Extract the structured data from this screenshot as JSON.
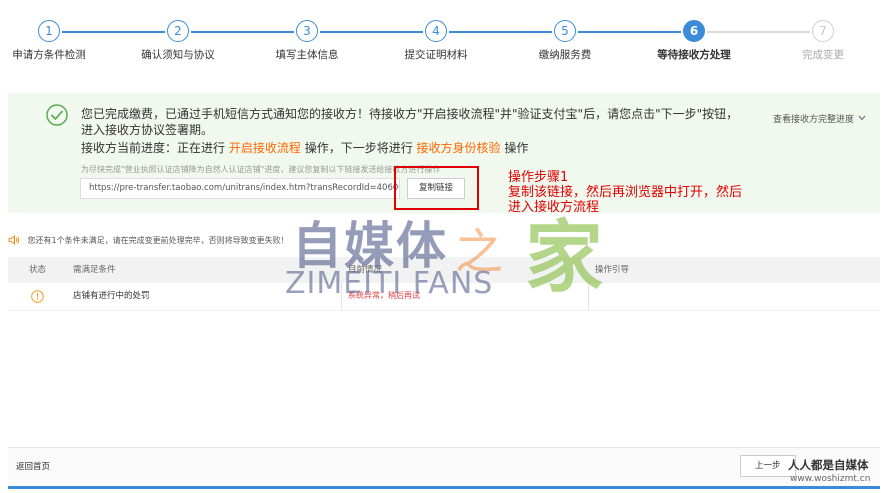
{
  "stepper": {
    "steps": [
      {
        "num": "1",
        "label": "申请方条件检测"
      },
      {
        "num": "2",
        "label": "确认须知与协议"
      },
      {
        "num": "3",
        "label": "填写主体信息"
      },
      {
        "num": "4",
        "label": "提交证明材料"
      },
      {
        "num": "5",
        "label": "缴纳服务费"
      },
      {
        "num": "6",
        "label": "等待接收方处理"
      },
      {
        "num": "7",
        "label": "完成变更"
      }
    ],
    "current_step": 6
  },
  "notice": {
    "message": "您已完成缴费，已通过手机短信方式通知您的接收方！待接收方\"开启接收流程\"并\"验证支付宝\"后，请您点击\"下一步\"按钮，进入接收方协议签署期。",
    "progress_prefix": "接收方当前进度：正在进行",
    "progress_current": "开启接收流程",
    "progress_mid": "操作，下一步将进行",
    "progress_next": "接收方身份核验",
    "progress_suffix": "操作",
    "view_progress": "查看接收方完整进度",
    "tip": "为尽快完成\"营业执照认证店铺降为自然人认证店铺\"进度，建议您复制以下链接发送给接收方进行操作",
    "link_value": "https://pre-transfer.taobao.com/unitrans/index.htm?transRecordId=406002&quo",
    "copy_button": "复制链接"
  },
  "annotation": {
    "title": "操作步骤1",
    "text": "复制该链接，然后再浏览器中打开，然后进入接收方流程"
  },
  "warning": {
    "text": "您还有1个条件未满足，请在完成变更前处理完毕，否则将导致变更失败！"
  },
  "table": {
    "headers": [
      "状态",
      "需满足条件",
      "目前情况",
      "操作引导"
    ],
    "rows": [
      {
        "condition": "店铺有进行中的处罚",
        "current": "系统异常，稍后再试"
      }
    ]
  },
  "watermark": {
    "cn": "自媒体",
    "zhi": "之",
    "jia": "家",
    "en": "ZIMEITI FANS"
  },
  "footer": {
    "back_home": "返回首页",
    "prev_button": "上一步"
  },
  "corner_watermark": {
    "line1": "人人都是自媒体",
    "line2": "www.woshizmt.cn"
  },
  "colors": {
    "accent": "#3c8bd9",
    "notice_bg": "#f1f8ee",
    "highlight": "#ff6600",
    "annotation": "#e00000"
  }
}
